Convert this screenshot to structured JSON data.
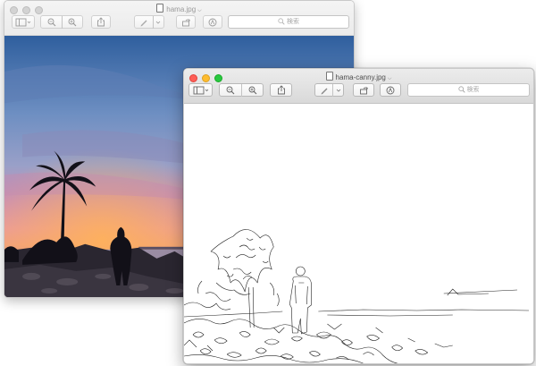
{
  "back_window": {
    "title": "hama.jpg",
    "search_placeholder": "検索"
  },
  "front_window": {
    "title": "hama-canny.jpg",
    "search_placeholder": "検索"
  },
  "icons": [
    "document-icon",
    "sidebar-icon",
    "zoom-out-icon",
    "zoom-in-icon",
    "share-icon",
    "markup-pen-icon",
    "rotate-icon",
    "annotate-icon",
    "search-icon"
  ]
}
